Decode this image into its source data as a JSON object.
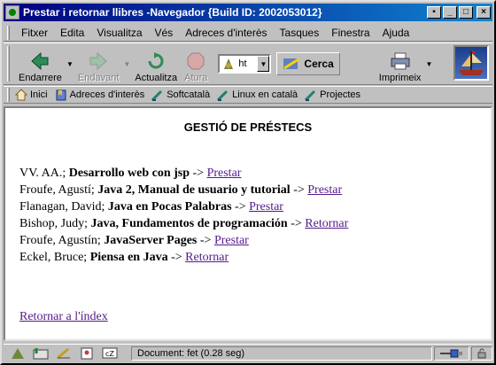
{
  "window": {
    "title": "Prestar i retornar llibres -Navegador {Build ID: 2002053012}"
  },
  "menu": {
    "items": [
      "Fitxer",
      "Edita",
      "Visualitza",
      "Vés",
      "Adreces d'interès",
      "Tasques",
      "Finestra",
      "Ajuda"
    ]
  },
  "toolbar": {
    "back_label": "Endarrere",
    "forward_label": "Endavant",
    "reload_label": "Actualitza",
    "stop_label": "Atura",
    "url_value": "ht",
    "search_label": "Cerca",
    "print_label": "Imprimeix"
  },
  "links": {
    "items": [
      "Inici",
      "Adreces d'interès",
      "Softcatalà",
      "Linux en català",
      "Projectes"
    ]
  },
  "page": {
    "heading": "GESTIÓ DE PRÉSTECS",
    "books": [
      {
        "author": "VV. AA.;",
        "title": "Desarrollo web con jsp",
        "arrow": "->",
        "action": "Prestar"
      },
      {
        "author": "Froufe, Agustí;",
        "title": "Java 2, Manual de usuario y tutorial",
        "arrow": "->",
        "action": "Prestar"
      },
      {
        "author": "Flanagan, David;",
        "title": "Java en Pocas Palabras",
        "arrow": "->",
        "action": "Prestar"
      },
      {
        "author": "Bishop, Judy;",
        "title": "Java, Fundamentos de programación",
        "arrow": "->",
        "action": "Retornar"
      },
      {
        "author": "Froufe, Agustín;",
        "title": "JavaServer Pages",
        "arrow": "->",
        "action": "Prestar"
      },
      {
        "author": "Eckel, Bruce;",
        "title": "Piensa en Java",
        "arrow": "->",
        "action": "Retornar"
      }
    ],
    "back_link": "Retornar a l'índex"
  },
  "status": {
    "text": "Document: fet (0.28 seg)"
  },
  "colors": {
    "titlebar_start": "#000080",
    "titlebar_end": "#1084d0",
    "visited_link": "#551a8b",
    "chrome": "#c0c0c0"
  }
}
